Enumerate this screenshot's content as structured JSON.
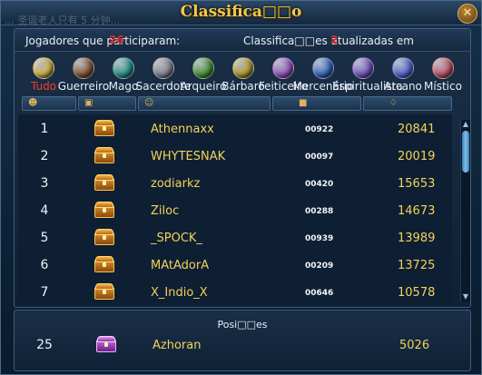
{
  "window": {
    "title": "Classifica□□o",
    "background_text": "… 圣诞老人只有 5 分钟…",
    "close_label": "✕"
  },
  "info": {
    "participants_label": "Jogadores que participaram:",
    "participants_value": "26",
    "updated_label": "Classifica□□es atualizadas em",
    "updated_value": "2"
  },
  "classes": [
    {
      "label": "Tudo",
      "icon": "smiley-icon",
      "color": "#d8b64a",
      "active": true
    },
    {
      "label": "Guerreiro",
      "icon": "warrior-icon",
      "color": "#8a5a3a",
      "active": false
    },
    {
      "label": "Mago",
      "icon": "mage-icon",
      "color": "#2a9a8a",
      "active": false
    },
    {
      "label": "Sacerdote",
      "icon": "priest-icon",
      "color": "#8a8a96",
      "active": false
    },
    {
      "label": "Arqueiro",
      "icon": "archer-icon",
      "color": "#4a9a3a",
      "active": false
    },
    {
      "label": "Bárbaro",
      "icon": "barbarian-icon",
      "color": "#b8a030",
      "active": false
    },
    {
      "label": "Feiticeiro",
      "icon": "sorcerer-icon",
      "color": "#9a5ac8",
      "active": false
    },
    {
      "label": "Mercenário",
      "icon": "mercenary-icon",
      "color": "#3a6ac8",
      "active": false
    },
    {
      "label": "Espiritualista",
      "icon": "spiritualist-icon",
      "color": "#7a5ac8",
      "active": false
    },
    {
      "label": "Arcano",
      "icon": "arcane-icon",
      "color": "#5a6ad8",
      "active": false
    },
    {
      "label": "Místico",
      "icon": "mystic-icon",
      "color": "#c85a6a",
      "active": false
    }
  ],
  "sort_icons": [
    "person-icon",
    "chest-icon",
    "name-icon",
    "book-icon",
    "trophy-icon"
  ],
  "rankings": [
    {
      "rank": "1",
      "name": "Athennaxx",
      "code": "00922",
      "score": "20841"
    },
    {
      "rank": "2",
      "name": "WHYTESNAK",
      "code": "00097",
      "score": "20019"
    },
    {
      "rank": "3",
      "name": "zodiarkz",
      "code": "00420",
      "score": "15653"
    },
    {
      "rank": "4",
      "name": "Ziloc",
      "code": "00288",
      "score": "14673"
    },
    {
      "rank": "5",
      "name": "_SPOCK_",
      "code": "00939",
      "score": "13989"
    },
    {
      "rank": "6",
      "name": "MAtAdorA",
      "code": "00209",
      "score": "13725"
    },
    {
      "rank": "7",
      "name": "X_Indio_X",
      "code": "00646",
      "score": "10578"
    }
  ],
  "position": {
    "title": "Posi□□es",
    "rank": "25",
    "name": "Azhoran",
    "score": "5026"
  },
  "colors": {
    "gold_text": "#f3d35a",
    "active_class": "#ff3a2a",
    "title": "#f3c94a"
  }
}
